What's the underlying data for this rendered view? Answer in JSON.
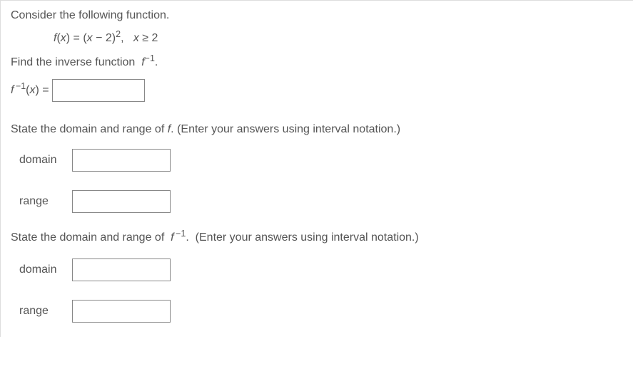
{
  "intro": "Consider the following function.",
  "function": {
    "lhs_f": "f",
    "lhs_open": "(",
    "lhs_x": "x",
    "lhs_close": ") = (",
    "inner_x": "x",
    "inner_minus": " − 2)",
    "exponent": "2",
    "comma": ",   ",
    "cond_x": "x",
    "cond_rest": " ≥ 2"
  },
  "find_inverse": {
    "prefix": "Find the inverse function  ",
    "f": "f",
    "sup": "−1",
    "period": "."
  },
  "inverse_label": {
    "f": "f",
    "sup": " −1",
    "open": "(",
    "x": "x",
    "close": ") ="
  },
  "section_f": {
    "prefix": "State the domain and range of ",
    "f": "f",
    "suffix": ". (Enter your answers using interval notation.)"
  },
  "section_finv": {
    "prefix": "State the domain and range of  ",
    "f": "f",
    "sup": " −1",
    "suffix": ".  (Enter your answers using interval notation.)"
  },
  "labels": {
    "domain": "domain",
    "range": "range"
  }
}
